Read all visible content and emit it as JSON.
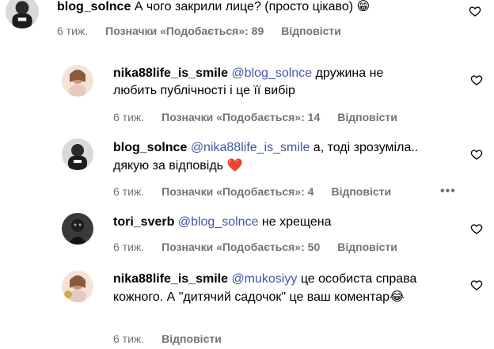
{
  "comments": [
    {
      "username": "blog_solnce",
      "text": "А чого закрили лице? (просто цікаво)",
      "emoji": "😁",
      "time": "6 тиж.",
      "likes": "Позначки «Подобається»: 89",
      "reply": "Відповісти"
    },
    {
      "username": "nika88life_is_smile",
      "mention": "@blog_solnce",
      "text": "дружина не любить публічності і це її вибір",
      "time": "6 тиж.",
      "likes": "Позначки «Подобається»: 14",
      "reply": "Відповісти"
    },
    {
      "username": "blog_solnce",
      "mention": "@nika88life_is_smile",
      "text": "а, тоді зрозуміла.. дякую за відповідь",
      "emoji": "❤️",
      "time": "6 тиж.",
      "likes": "Позначки «Подобається»: 4",
      "reply": "Відповісти",
      "more": "•••"
    },
    {
      "username": "tori_sverb",
      "mention": "@blog_solnce",
      "text": "не хрещена",
      "time": "6 тиж.",
      "likes": "Позначки «Подобається»: 50",
      "reply": "Відповісти"
    },
    {
      "username": "nika88life_is_smile",
      "mention": "@mukosiyy",
      "text": "це особиста справа кожного. А \"дитячий садочок\" це ваш коментар",
      "emoji": "😂",
      "time": "6 тиж.",
      "reply": "Відповісти"
    }
  ],
  "icons": {
    "like": "heart-outline-icon",
    "more": "more-options-icon"
  },
  "colors": {
    "mention": "#4256a8",
    "meta": "#737373",
    "heart_emoji": "#e0245e"
  }
}
